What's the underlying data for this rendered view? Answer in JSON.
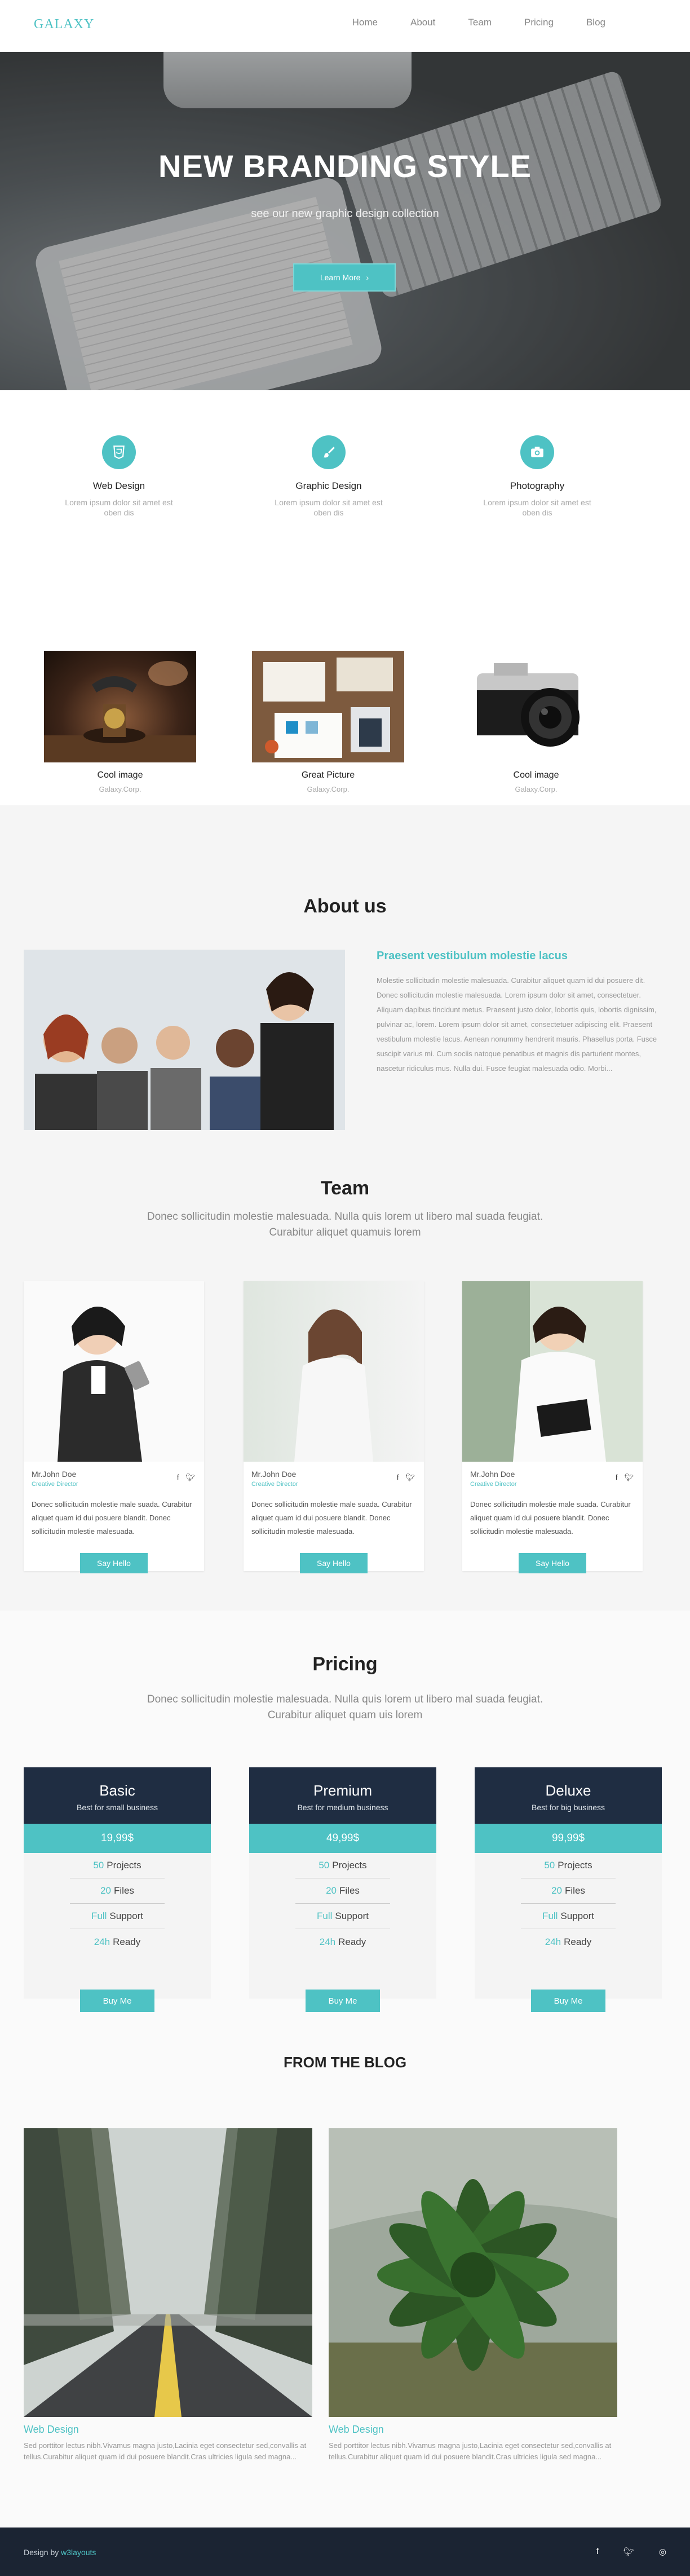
{
  "nav": {
    "logo": "GALAXY",
    "links": [
      "Home",
      "About",
      "Team",
      "Pricing",
      "Blog"
    ]
  },
  "hero": {
    "title": "NEW BRANDING STYLE",
    "subtitle": "see our new graphic design collection",
    "button_label": "Learn More",
    "button_icon": "chevron-right-icon"
  },
  "services": [
    {
      "icon": "html5-icon",
      "title": "Web Design",
      "text": "Lorem ipsum dolor sit amet est oben dis"
    },
    {
      "icon": "brush-icon",
      "title": "Graphic Design",
      "text": "Lorem ipsum dolor sit amet est oben dis"
    },
    {
      "icon": "camera-icon",
      "title": "Photography",
      "text": "Lorem ipsum dolor sit amet est oben dis"
    }
  ],
  "works": [
    {
      "title": "Cool image",
      "subtitle": "Galaxy.Corp."
    },
    {
      "title": "Great Picture",
      "subtitle": "Galaxy.Corp."
    },
    {
      "title": "Cool image",
      "subtitle": "Galaxy.Corp."
    }
  ],
  "about": {
    "title": "About us",
    "heading": "Praesent vestibulum molestie lacus",
    "text": "Molestie sollicitudin molestie malesuada. Curabitur aliquet quam id dui posuere dit. Donec sollicitudin molestie malesuada. Lorem ipsum dolor sit amet, consectetuer. Aliquam dapibus tincidunt metus. Praesent justo dolor, lobortis quis, lobortis dignissim, pulvinar ac, lorem. Lorem ipsum dolor sit amet, consectetuer adipiscing elit. Praesent vestibulum molestie lacus. Aenean nonummy hendrerit mauris. Phasellus porta. Fusce suscipit varius mi. Cum sociis natoque penatibus et magnis dis parturient montes, nascetur ridiculus mus. Nulla dui. Fusce feugiat malesuada odio. Morbi..."
  },
  "team": {
    "title": "Team",
    "subtitle": "Donec sollicitudin molestie malesuada. Nulla quis lorem ut libero mal suada feugiat. Curabitur aliquet quamuis lorem",
    "members": [
      {
        "name": "Mr.John Doe",
        "role": "Creative Director",
        "text": "Donec sollicitudin molestie male suada. Curabitur aliquet quam id dui posuere blandit. Donec sollicitudin molestie malesuada.",
        "button": "Say Hello"
      },
      {
        "name": "Mr.John Doe",
        "role": "Creative Director",
        "text": "Donec sollicitudin molestie male suada. Curabitur aliquet quam id dui posuere blandit. Donec sollicitudin molestie malesuada.",
        "button": "Say Hello"
      },
      {
        "name": "Mr.John Doe",
        "role": "Creative Director",
        "text": "Donec sollicitudin molestie male suada. Curabitur aliquet quam id dui posuere blandit. Donec sollicitudin molestie malesuada.",
        "button": "Say Hello"
      }
    ],
    "social_icons": [
      "facebook-icon",
      "twitter-icon"
    ]
  },
  "pricing": {
    "title": "Pricing",
    "subtitle": "Donec sollicitudin molestie malesuada. Nulla quis lorem ut libero mal suada feugiat. Curabitur aliquet quam uis lorem",
    "plans": [
      {
        "name": "Basic",
        "desc": "Best for small business",
        "price": "19,99$",
        "features": [
          {
            "num": "50",
            "label": "Projects"
          },
          {
            "num": "20",
            "label": "Files"
          },
          {
            "num": "Full",
            "label": "Support"
          },
          {
            "num": "24h",
            "label": "Ready"
          }
        ],
        "button": "Buy Me"
      },
      {
        "name": "Premium",
        "desc": "Best for medium business",
        "price": "49,99$",
        "features": [
          {
            "num": "50",
            "label": "Projects"
          },
          {
            "num": "20",
            "label": "Files"
          },
          {
            "num": "Full",
            "label": "Support"
          },
          {
            "num": "24h",
            "label": "Ready"
          }
        ],
        "button": "Buy Me"
      },
      {
        "name": "Deluxe",
        "desc": "Best for big business",
        "price": "99,99$",
        "features": [
          {
            "num": "50",
            "label": "Projects"
          },
          {
            "num": "20",
            "label": "Files"
          },
          {
            "num": "Full",
            "label": "Support"
          },
          {
            "num": "24h",
            "label": "Ready"
          }
        ],
        "button": "Buy Me"
      }
    ]
  },
  "blog": {
    "title": "FROM THE BLOG",
    "posts": [
      {
        "title": "Web Design",
        "text": "Sed porttitor lectus nibh.Vivamus magna justo,Lacinia eget consectetur sed,convallis at tellus.Curabitur aliquet quam id dui posuere blandit.Cras ultricies ligula sed magna..."
      },
      {
        "title": "Web Design",
        "text": "Sed porttitor lectus nibh.Vivamus magna justo,Lacinia eget consectetur sed,convallis at tellus.Curabitur aliquet quam id dui posuere blandit.Cras ultricies ligula sed magna..."
      }
    ]
  },
  "footer": {
    "credit_prefix": "Design by",
    "credit_brand": "w3layouts",
    "social_icons": [
      "facebook-icon",
      "twitter-icon",
      "dribbble-icon"
    ]
  },
  "colors": {
    "accent": "#4ec2c4",
    "dark": "#1f2d42",
    "footer": "#1b2433"
  }
}
